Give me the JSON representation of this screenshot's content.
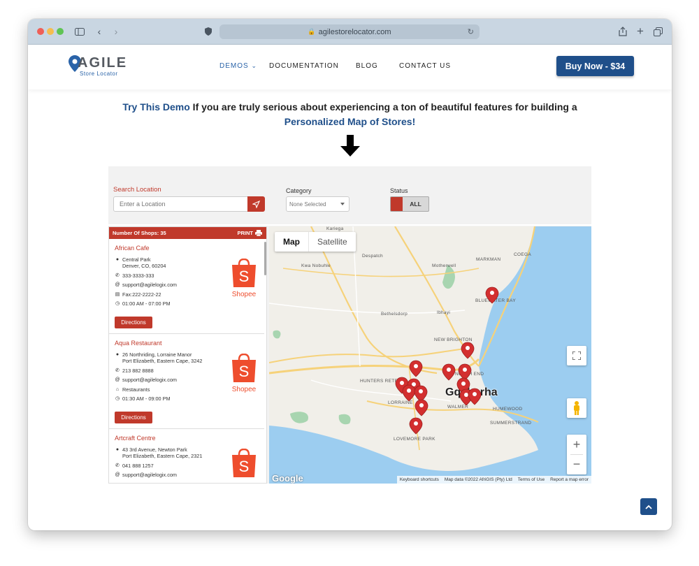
{
  "browser": {
    "url": "agilestorelocator.com"
  },
  "header": {
    "logo_word": "AGILE",
    "logo_sub": "Store Locator",
    "nav": [
      {
        "label": "DEMOS"
      },
      {
        "label": "DOCUMENTATION"
      },
      {
        "label": "BLOG"
      },
      {
        "label": "CONTACT US"
      }
    ],
    "buy_label": "Buy Now - $34"
  },
  "intro": {
    "link1": "Try This Demo",
    "text": " If you are truly serious about experiencing a ton of beautiful features for building a ",
    "link2": "Personalized Map of Stores!"
  },
  "demo": {
    "search_label": "Search Location",
    "search_placeholder": "Enter a Location",
    "category_label": "Category",
    "category_value": "None Selected",
    "status_label": "Status",
    "status_value": "ALL",
    "list_count": "Number Of Shops: 35",
    "print_label": "PRINT",
    "directions_label": "Directions",
    "logo_text": "Shopee",
    "stores": [
      {
        "name": "African Cafe",
        "addr1": "Central Park",
        "addr2": "Denver, CO, 60204",
        "phone": "333-3333-333",
        "email": "support@agilelogix.com",
        "extra": "Fax:222-2222-22",
        "hours": "01:00 AM - 07:00 PM"
      },
      {
        "name": "Aqua Restaurant",
        "addr1": "26 Northriding, Lorraine Manor",
        "addr2": "Port Elizabeth, Eastern Cape, 3242",
        "phone": "213 882 8888",
        "email": "support@agilelogix.com",
        "extra": "Restaurants",
        "hours": "01:30 AM - 09:00 PM"
      },
      {
        "name": "Artcraft Centre",
        "addr1": "43 3rd Avenue, Newton Park",
        "addr2": "Port Elizabeth, Eastern Cape, 2321",
        "phone": "041 888 1257",
        "email": "support@agilelogix.com"
      }
    ]
  },
  "map": {
    "type_map": "Map",
    "type_satellite": "Satellite",
    "city_label": "Gqeberha",
    "places": [
      "Kariega",
      "Despatch",
      "Kwa Nobuhle",
      "Motherwell",
      "MARKMAN",
      "COEGA",
      "BLUEWATER BAY",
      "Bethelsdorp",
      "Ibhayi",
      "NEW BRIGHTON",
      "NORTH END",
      "HUNTERS RETREAT",
      "LORRAINE",
      "WALMER",
      "HUMEWOOD",
      "SUMMERSTRAND",
      "LOVEMORE PARK"
    ],
    "google": "Google",
    "attribution": [
      "Keyboard shortcuts",
      "Map data ©2022 AfriGIS (Pty) Ltd",
      "Terms of Use",
      "Report a map error"
    ]
  }
}
